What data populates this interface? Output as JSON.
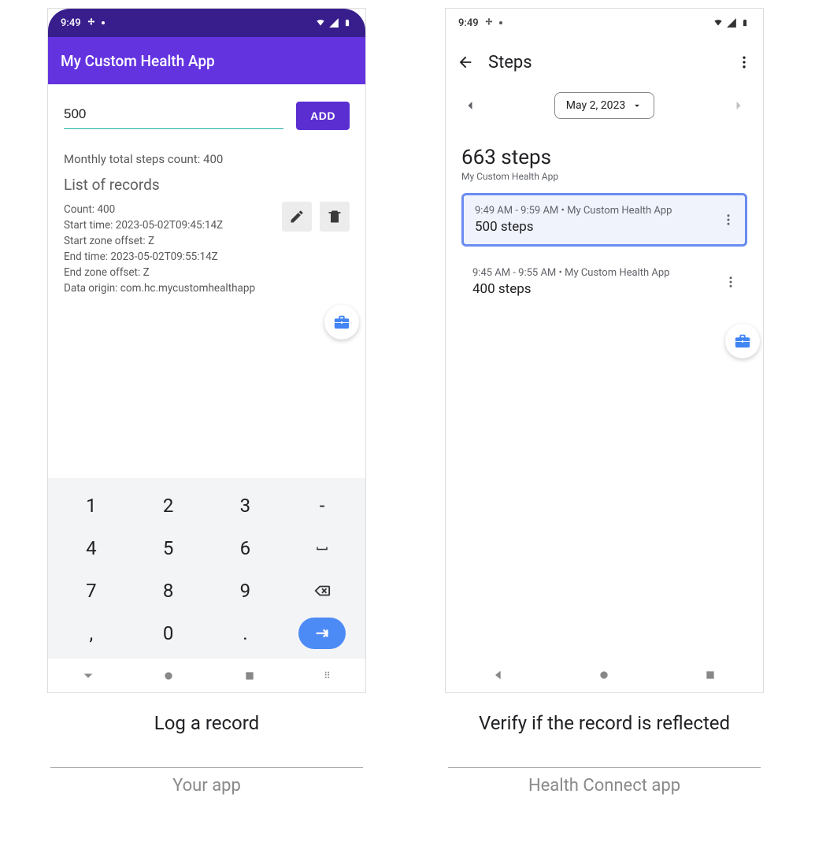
{
  "status": {
    "time": "9:49"
  },
  "left": {
    "app_title": "My Custom Health App",
    "input_value": "500",
    "add_label": "ADD",
    "monthly_text": "Monthly total steps count: 400",
    "list_title": "List of records",
    "record": {
      "count": "Count: 400",
      "start_time": "Start time: 2023-05-02T09:45:14Z",
      "start_zone": "Start zone offset: Z",
      "end_time": "End time: 2023-05-02T09:55:14Z",
      "end_zone": "End zone offset: Z",
      "origin": "Data origin: com.hc.mycustomhealthapp"
    },
    "keyboard": {
      "rows": [
        [
          "1",
          "2",
          "3",
          "-"
        ],
        [
          "4",
          "5",
          "6",
          "␣"
        ],
        [
          "7",
          "8",
          "9",
          "⌫"
        ],
        [
          ",",
          "0",
          ".",
          "↵"
        ]
      ]
    }
  },
  "right": {
    "title": "Steps",
    "date_label": "May 2, 2023",
    "summary_value": "663 steps",
    "summary_source": "My Custom Health App",
    "entries": [
      {
        "meta": "9:49 AM - 9:59 AM • My Custom Health App",
        "value": "500 steps",
        "highlight": true
      },
      {
        "meta": "9:45 AM - 9:55 AM • My Custom Health App",
        "value": "400 steps",
        "highlight": false
      }
    ]
  },
  "captions": {
    "left_step": "Log a record",
    "left_sub": "Your app",
    "right_step": "Verify if the record is reflected",
    "right_sub": "Health Connect app"
  }
}
